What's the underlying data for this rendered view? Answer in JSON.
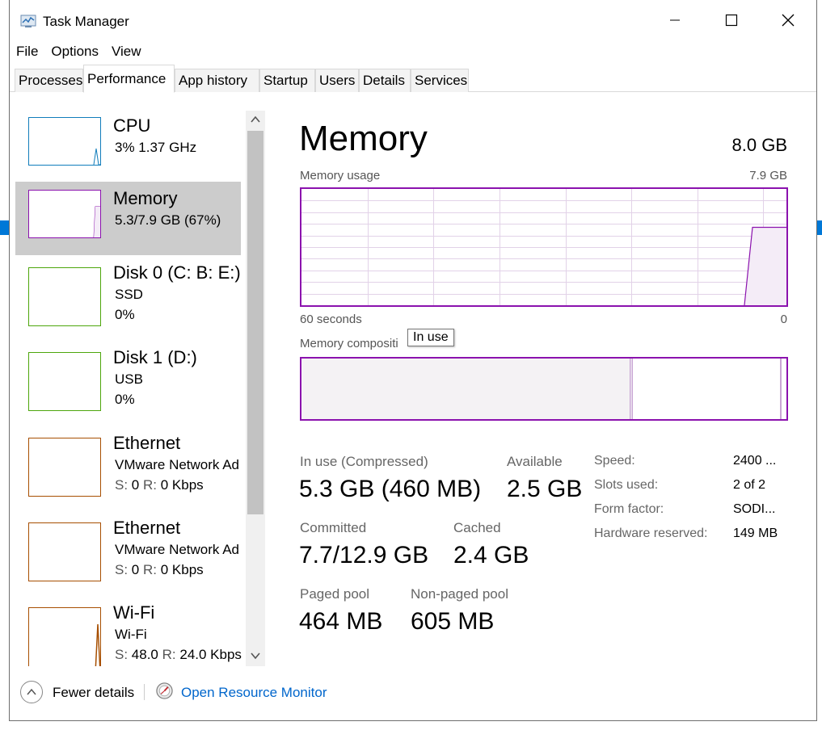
{
  "window": {
    "title": "Task Manager",
    "controls": {
      "minimize": "minimize",
      "maximize": "maximize",
      "close": "close"
    }
  },
  "menu": [
    "File",
    "Options",
    "View"
  ],
  "tabs": [
    {
      "label": "Processes",
      "active": false
    },
    {
      "label": "Performance",
      "active": true
    },
    {
      "label": "App history",
      "active": false
    },
    {
      "label": "Startup",
      "active": false
    },
    {
      "label": "Users",
      "active": false
    },
    {
      "label": "Details",
      "active": false
    },
    {
      "label": "Services",
      "active": false
    }
  ],
  "sidebar": {
    "items": [
      {
        "name": "CPU",
        "line1": "3%  1.37 GHz",
        "line2": "",
        "color": "#117dbb",
        "selected": false
      },
      {
        "name": "Memory",
        "line1": "5.3/7.9 GB (67%)",
        "line2": "",
        "color": "#8b12ae",
        "selected": true
      },
      {
        "name": "Disk 0 (C: B: E:)",
        "line1": "SSD",
        "line2": "0%",
        "color": "#4da60c",
        "selected": false
      },
      {
        "name": "Disk 1 (D:)",
        "line1": "USB",
        "line2": "0%",
        "color": "#4da60c",
        "selected": false
      },
      {
        "name": "Ethernet",
        "line1": "VMware Network Ad",
        "line2_s": "S:",
        "line2_sv": "0",
        "line2_r": "R:",
        "line2_rv": "0 Kbps",
        "color": "#a74f01",
        "selected": false
      },
      {
        "name": "Ethernet",
        "line1": "VMware Network Ad",
        "line2_s": "S:",
        "line2_sv": "0",
        "line2_r": "R:",
        "line2_rv": "0 Kbps",
        "color": "#a74f01",
        "selected": false
      },
      {
        "name": "Wi-Fi",
        "line1": "Wi-Fi",
        "line2_s": "S:",
        "line2_sv": "48.0",
        "line2_r": "R:",
        "line2_rv": "24.0 Kbps",
        "color": "#a74f01",
        "selected": false
      }
    ]
  },
  "memory": {
    "title": "Memory",
    "total": "8.0 GB",
    "usage_label": "Memory usage",
    "usage_max": "7.9 GB",
    "axis_left": "60 seconds",
    "axis_right": "0",
    "composition_label": "Memory compositi",
    "tooltip": "In use",
    "usage_fraction": 0.67,
    "stats": {
      "in_use_label": "In use (Compressed)",
      "in_use_value": "5.3 GB (460 MB)",
      "available_label": "Available",
      "available_value": "2.5 GB",
      "committed_label": "Committed",
      "committed_value": "7.7/12.9 GB",
      "cached_label": "Cached",
      "cached_value": "2.4 GB",
      "paged_label": "Paged pool",
      "paged_value": "464 MB",
      "nonpaged_label": "Non-paged pool",
      "nonpaged_value": "605 MB"
    },
    "specs": [
      {
        "label": "Speed:",
        "value": "2400 ..."
      },
      {
        "label": "Slots used:",
        "value": "2 of 2"
      },
      {
        "label": "Form factor:",
        "value": "SODI..."
      },
      {
        "label": "Hardware reserved:",
        "value": "149 MB"
      }
    ]
  },
  "footer": {
    "fewer_details": "Fewer details",
    "open_resource_monitor": "Open Resource Monitor"
  },
  "colors": {
    "memory_accent": "#8b12ae",
    "selected_bg": "#cccccc",
    "link": "#0066cc"
  }
}
